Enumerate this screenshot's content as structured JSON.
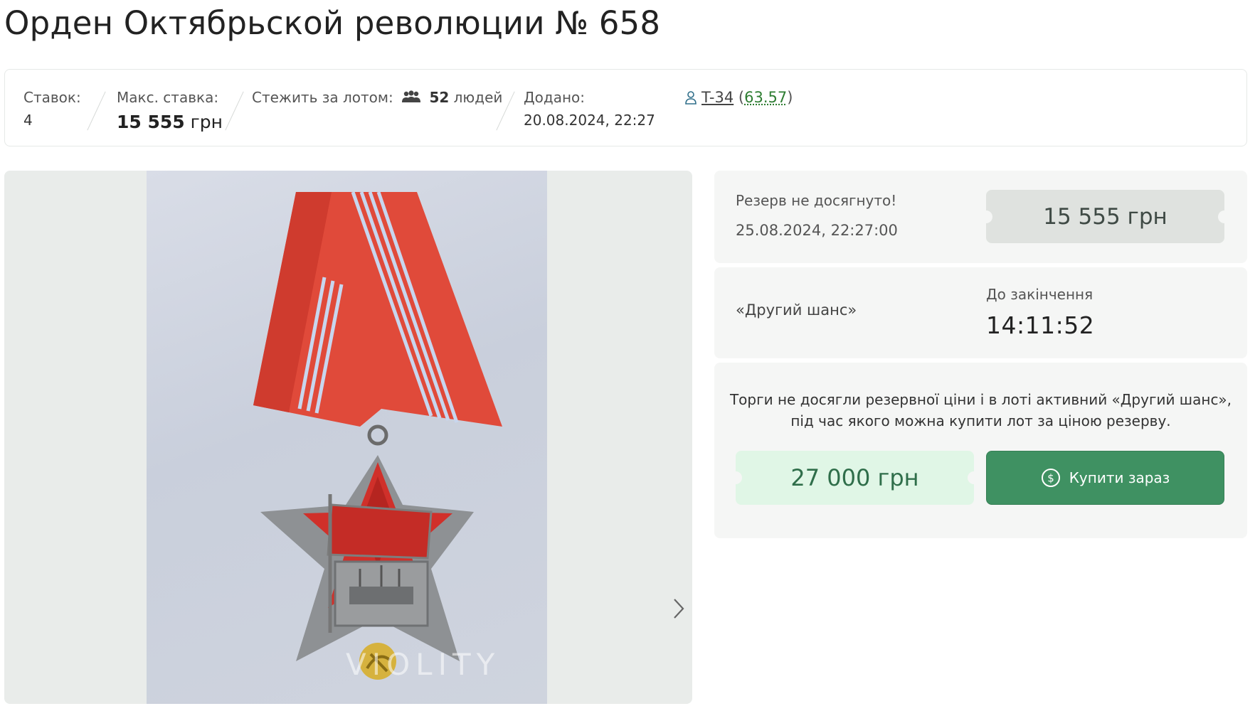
{
  "lot": {
    "title": "Орден Октябрьской революции № 658"
  },
  "info": {
    "bids_label": "Ставок:",
    "bids_value": "4",
    "max_bid_label": "Макс. ставка:",
    "max_bid_amount": "15 555",
    "max_bid_currency": "грн",
    "watch_label": "Стежить за лотом:",
    "watch_icon": "users-icon",
    "watch_count": "52",
    "watch_unit": "людей",
    "added_label": "Додано:",
    "added_value": "20.08.2024, 22:27",
    "seller_icon": "person-icon",
    "seller_name": "T-34",
    "seller_rating": "63.57"
  },
  "gallery": {
    "watermark": "VIOLITY",
    "next_icon": "chevron-right-icon"
  },
  "reserve": {
    "status": "Резерв не досягнуто!",
    "end_date": "25.08.2024, 22:27:00",
    "current_price": "15 555 грн"
  },
  "second_chance": {
    "label": "«Другий шанс»",
    "until_label": "До закінчення",
    "countdown": "14:11:52"
  },
  "buy_now": {
    "notice_line1": "Торги не досягли резервної ціни і в лоті активний «Другий шанс»,",
    "notice_line2": "під час якого можна купити лот за ціною резерву.",
    "price": "27 000 грн",
    "button_label": "Купити зараз",
    "button_icon": "coin-icon"
  },
  "colors": {
    "accent_green": "#3f9162",
    "green_ticket": "#e0f6e6",
    "panel_bg": "#f5f6f5"
  }
}
